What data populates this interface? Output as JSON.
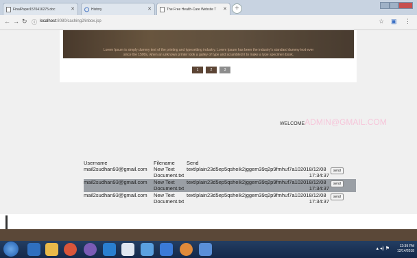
{
  "browser": {
    "tabs": [
      {
        "label": "FinalPaper1570416275.doc",
        "active": false
      },
      {
        "label": "History",
        "active": false
      },
      {
        "label": "The Free Health-Care Website T",
        "active": true
      }
    ],
    "url_host": "localhost",
    "url_path": ":8080/caching2/inbox.jsp"
  },
  "page": {
    "banner_line1": "Lorem Ipsum is simply dummy text of the printing and typesetting industry. Lorem Ipsum has been the industry's standard dummy text ever",
    "banner_line2": "since the 1500s, when an unknown printer took a galley of type and scrambled it to make a type specimen book.",
    "pages": [
      "1",
      "2",
      "3"
    ],
    "welcome_label": "WELCOME",
    "welcome_email": "ADMIN@GMAIL.COM"
  },
  "table": {
    "headers": [
      "Username",
      "Filename",
      "Send"
    ],
    "rows": [
      {
        "username": "mail2sudhan93@gmail.com",
        "filename": "New Text Document.txt",
        "send": "text/plain23d5ep5qsheik2jggem39q2p9fmhuf7a102018/12/08",
        "time": "17:34:37",
        "button": "send"
      },
      {
        "username": "mail2sudhan93@gmail.com",
        "filename": "New Text Document.txt",
        "send": "text/plain23d5ep5qsheik2jggem39q2p9fmhuf7a102018/12/08",
        "time": "17:34:37",
        "button": "send"
      },
      {
        "username": "mail2sudhan93@gmail.com",
        "filename": "New Text Document.txt",
        "send": "text/plain23d5ep5qsheik2jggem39q2p9fmhuf7a102018/12/08",
        "time": "17:34:37",
        "button": "send"
      }
    ]
  },
  "taskbar": {
    "time": "12:39 PM",
    "date": "12/14/2018"
  }
}
